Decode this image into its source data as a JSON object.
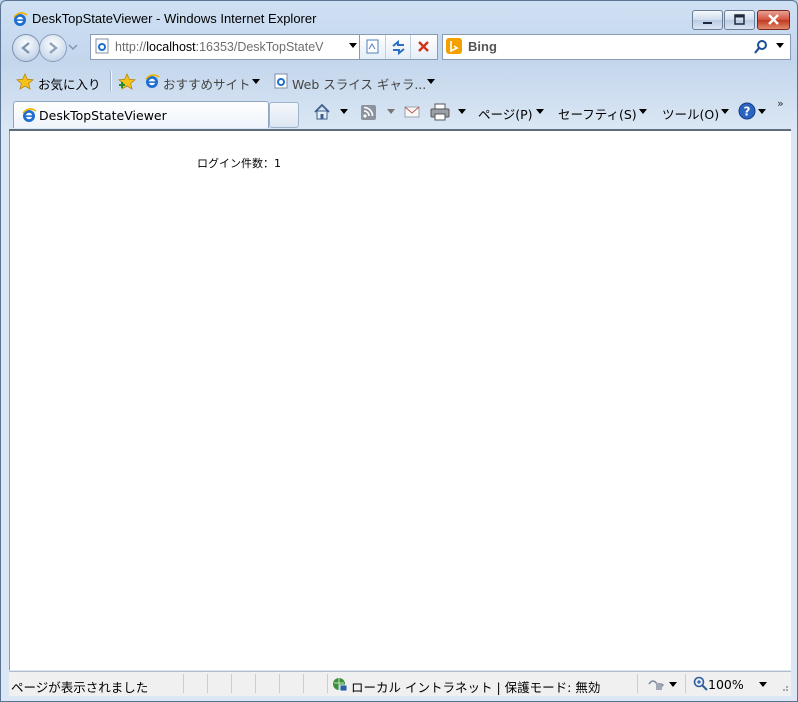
{
  "window": {
    "title": "DeskTopStateViewer - Windows Internet Explorer"
  },
  "address": {
    "scheme": "http://",
    "host": "localhost",
    "rest": ":16353/DeskTopStateV"
  },
  "search": {
    "provider": "Bing"
  },
  "favorites": {
    "label": "お気に入り",
    "items": [
      {
        "label": "おすすめサイト"
      },
      {
        "label": "Web スライス ギャラ..."
      }
    ]
  },
  "tab": {
    "title": "DeskTopStateViewer"
  },
  "commandbar": {
    "page": "ページ(P)",
    "safety": "セーフティ(S)",
    "tools": "ツール(O)",
    "overflow": "»"
  },
  "content": {
    "login_count": "ログイン件数：1"
  },
  "statusbar": {
    "text": "ページが表示されました",
    "zone": "ローカル イントラネット | 保護モード: 無効",
    "zoom": "100%"
  },
  "colors": {
    "close_button": "#c2381f",
    "bing": "#f4a100",
    "ie_blue": "#1f6fd1"
  }
}
